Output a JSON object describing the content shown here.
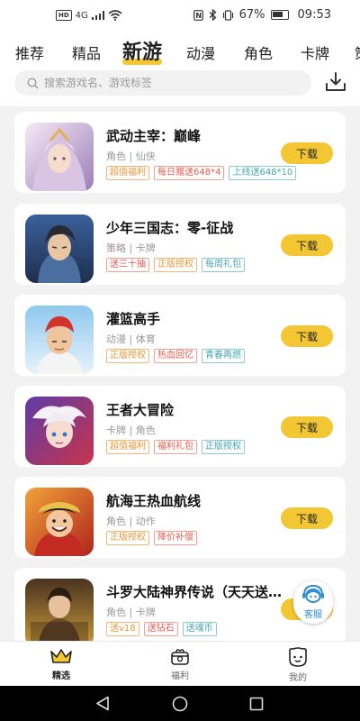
{
  "status_bar": {
    "signal": "4G",
    "battery": "67%",
    "time": "09:53"
  },
  "tabs": [
    {
      "label": "推荐"
    },
    {
      "label": "精品"
    },
    {
      "label": "新游",
      "active": true
    },
    {
      "label": "动漫"
    },
    {
      "label": "角色"
    },
    {
      "label": "卡牌"
    }
  ],
  "search": {
    "placeholder": "搜索游戏名、游戏标签"
  },
  "colors": {
    "accent": "#f3c633",
    "tag_orange": "#e8973a",
    "tag_red": "#e55c4d",
    "tag_teal": "#45a6b2",
    "service_blue": "#2e8fd6"
  },
  "games": [
    {
      "title": "武动主宰：巅峰",
      "category": "角色 | 仙侠",
      "tags": [
        {
          "text": "超值福利",
          "color": "orange"
        },
        {
          "text": "每日赠送648*4",
          "color": "red"
        },
        {
          "text": "上线送648*10",
          "color": "teal"
        }
      ],
      "button": "下载"
    },
    {
      "title": "少年三国志：零-征战",
      "category": "策略 | 卡牌",
      "tags": [
        {
          "text": "送三十抽",
          "color": "red"
        },
        {
          "text": "正版授权",
          "color": "orange"
        },
        {
          "text": "每周礼包",
          "color": "teal"
        }
      ],
      "button": "下载"
    },
    {
      "title": "灌篮高手",
      "category": "动漫 | 体育",
      "tags": [
        {
          "text": "正版授权",
          "color": "orange"
        },
        {
          "text": "热血回忆",
          "color": "red"
        },
        {
          "text": "青春再燃",
          "color": "teal"
        }
      ],
      "button": "下载"
    },
    {
      "title": "王者大冒险",
      "category": "卡牌 | 角色",
      "tags": [
        {
          "text": "超值福利",
          "color": "orange"
        },
        {
          "text": "福利礼包",
          "color": "red"
        },
        {
          "text": "正版授权",
          "color": "teal"
        }
      ],
      "button": "下载"
    },
    {
      "title": "航海王热血航线",
      "category": "角色 | 动作",
      "tags": [
        {
          "text": "正版授权",
          "color": "orange"
        },
        {
          "text": "降价补偿",
          "color": "red"
        }
      ],
      "button": "下载"
    },
    {
      "title": "斗罗大陆神界传说（天天送…",
      "category": "角色 | 卡牌",
      "tags": [
        {
          "text": "送v18",
          "color": "orange"
        },
        {
          "text": "送钻石",
          "color": "red"
        },
        {
          "text": "送魂币",
          "color": "teal"
        }
      ],
      "button": "下载"
    }
  ],
  "customer_service": {
    "label": "客服"
  },
  "bottom_nav": [
    {
      "label": "精选",
      "icon": "crown-icon",
      "active": true
    },
    {
      "label": "福利",
      "icon": "gift-box-icon"
    },
    {
      "label": "我的",
      "icon": "smiley-face-icon"
    }
  ]
}
